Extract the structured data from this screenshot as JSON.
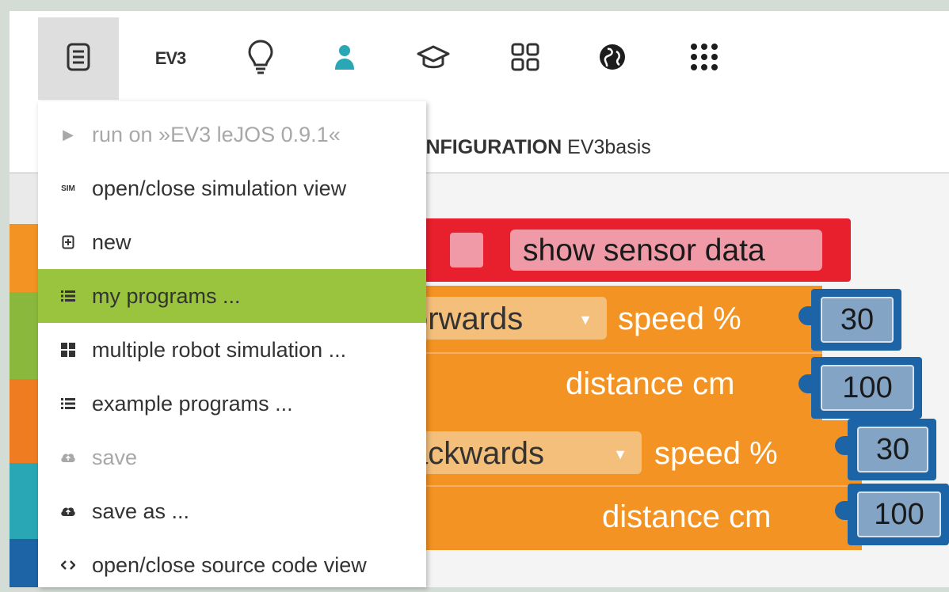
{
  "toolbar": {
    "icons": [
      {
        "name": "program-icon",
        "active": true
      },
      {
        "name": "ev3-robot",
        "label": "EV3"
      },
      {
        "name": "help-icon"
      },
      {
        "name": "user-icon"
      },
      {
        "name": "gallery-icon"
      },
      {
        "name": "tutorial-icon"
      },
      {
        "name": "language-icon"
      },
      {
        "name": "apps-icon"
      }
    ]
  },
  "tabbar": {
    "config_prefix": "ONFIGURATION",
    "config_name": "EV3basis"
  },
  "menu": {
    "items": [
      {
        "icon": "play-icon",
        "label": "run on »EV3 leJOS 0.9.1«",
        "enabled": false
      },
      {
        "icon": "sim-icon",
        "icon_text": "SIM",
        "label": "open/close simulation view",
        "enabled": true
      },
      {
        "icon": "new-file-icon",
        "label": "new",
        "enabled": true
      },
      {
        "icon": "list-icon",
        "label": "my programs ...",
        "enabled": true,
        "highlighted": true
      },
      {
        "icon": "grid-icon",
        "label": "multiple robot simulation ...",
        "enabled": true
      },
      {
        "icon": "list-icon",
        "label": "example programs ...",
        "enabled": true
      },
      {
        "icon": "cloud-save-icon",
        "label": "save",
        "enabled": false
      },
      {
        "icon": "cloud-save-icon",
        "label": "save as ...",
        "enabled": true
      },
      {
        "icon": "code-icon",
        "label": "open/close source code view",
        "enabled": true
      }
    ]
  },
  "workspace": {
    "sensor_block": {
      "label": "show sensor data"
    },
    "drive_forward": {
      "direction": "orwards",
      "speed_label": "speed %",
      "speed_value": "30",
      "distance_label": "distance cm",
      "distance_value": "100"
    },
    "drive_backward": {
      "direction": "ackwards",
      "speed_label": "speed %",
      "speed_value": "30",
      "distance_label": "distance cm",
      "distance_value": "100"
    }
  },
  "colors": {
    "accent_green": "#9ac43d",
    "block_orange": "#f39323",
    "block_red": "#e8202e",
    "number_blue": "#1c64a6",
    "teal": "#29a7b5"
  }
}
